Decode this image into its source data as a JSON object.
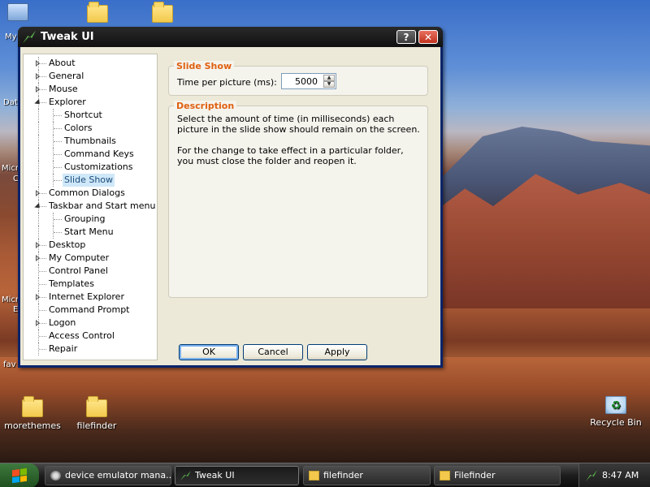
{
  "desktop": {
    "icons": [
      {
        "label": "morethemes",
        "icon": "folder-icon"
      },
      {
        "label": "filefinder",
        "icon": "folder-icon"
      },
      {
        "label": "Recycle Bin",
        "icon": "recycle-bin-icon"
      }
    ],
    "edge_labels": [
      "My",
      "Dat",
      "Micr",
      "C",
      "Micr",
      "E",
      "fav"
    ]
  },
  "window": {
    "title": "Tweak UI",
    "help_glyph": "?",
    "close_glyph": "✕"
  },
  "tree": {
    "items": [
      {
        "label": "About",
        "expander": "collapsed",
        "level": 0
      },
      {
        "label": "General",
        "expander": "collapsed",
        "level": 0
      },
      {
        "label": "Mouse",
        "expander": "collapsed",
        "level": 0
      },
      {
        "label": "Explorer",
        "expander": "expanded",
        "level": 0
      },
      {
        "label": "Shortcut",
        "expander": "none",
        "level": 1
      },
      {
        "label": "Colors",
        "expander": "none",
        "level": 1
      },
      {
        "label": "Thumbnails",
        "expander": "none",
        "level": 1
      },
      {
        "label": "Command Keys",
        "expander": "none",
        "level": 1
      },
      {
        "label": "Customizations",
        "expander": "none",
        "level": 1
      },
      {
        "label": "Slide Show",
        "expander": "none",
        "level": 1,
        "selected": true
      },
      {
        "label": "Common Dialogs",
        "expander": "collapsed",
        "level": 0
      },
      {
        "label": "Taskbar and Start menu",
        "expander": "expanded",
        "level": 0
      },
      {
        "label": "Grouping",
        "expander": "none",
        "level": 1
      },
      {
        "label": "Start Menu",
        "expander": "none",
        "level": 1
      },
      {
        "label": "Desktop",
        "expander": "collapsed",
        "level": 0
      },
      {
        "label": "My Computer",
        "expander": "collapsed",
        "level": 0
      },
      {
        "label": "Control Panel",
        "expander": "none",
        "level": 0
      },
      {
        "label": "Templates",
        "expander": "none",
        "level": 0
      },
      {
        "label": "Internet Explorer",
        "expander": "collapsed",
        "level": 0
      },
      {
        "label": "Command Prompt",
        "expander": "none",
        "level": 0
      },
      {
        "label": "Logon",
        "expander": "collapsed",
        "level": 0
      },
      {
        "label": "Access Control",
        "expander": "none",
        "level": 0
      },
      {
        "label": "Repair",
        "expander": "none",
        "level": 0
      }
    ]
  },
  "slideshow": {
    "group_title": "Slide Show",
    "field_label": "Time per picture (ms):",
    "value": "5000",
    "up_glyph": "▲",
    "down_glyph": "▼"
  },
  "description": {
    "title": "Description",
    "para1": "Select the amount of time (in milliseconds) each picture in the slide show should remain on the screen.",
    "para2": "For the change to take effect in a particular folder, you must close the folder and reopen it."
  },
  "buttons": {
    "ok": "OK",
    "cancel": "Cancel",
    "apply": "Apply"
  },
  "taskbar": {
    "tasks": [
      {
        "label": "device emulator mana...",
        "icon": "emulator-icon"
      },
      {
        "label": "Tweak UI",
        "icon": "tweakui-icon",
        "active": true
      },
      {
        "label": "filefinder",
        "icon": "folder-icon"
      },
      {
        "label": "Filefinder",
        "icon": "folder-icon"
      }
    ],
    "clock": "8:47 AM"
  },
  "colors": {
    "accent_title": "#e06010",
    "selection": "#cfe8f8"
  }
}
